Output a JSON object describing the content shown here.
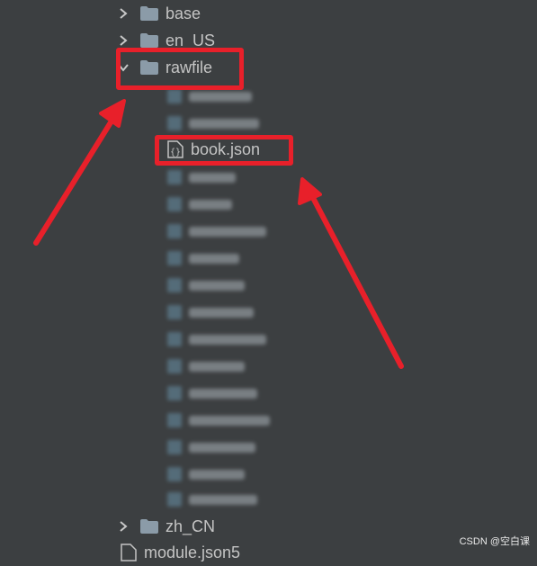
{
  "tree": {
    "folders": [
      {
        "label": "base",
        "expanded": false
      },
      {
        "label": "en_US",
        "expanded": false
      },
      {
        "label": "rawfile",
        "expanded": true
      },
      {
        "label": "zh_CN",
        "expanded": false
      }
    ],
    "highlighted_file": "book.json",
    "last_item": "module.json5"
  },
  "watermark": "CSDN @空白课",
  "colors": {
    "background": "#3c3f41",
    "highlight": "#e8202a",
    "folder": "#8b9ba8"
  }
}
